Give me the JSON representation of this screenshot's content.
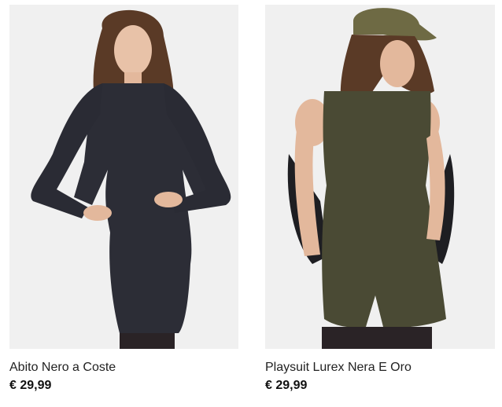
{
  "products": [
    {
      "name": "Abito Nero a Coste",
      "price": "€ 29,99",
      "image_icon": "model-black-ribbed-dress-photo"
    },
    {
      "name": "Playsuit Lurex Nera E Oro",
      "price": "€ 29,99",
      "image_icon": "model-lurex-playsuit-photo"
    }
  ]
}
